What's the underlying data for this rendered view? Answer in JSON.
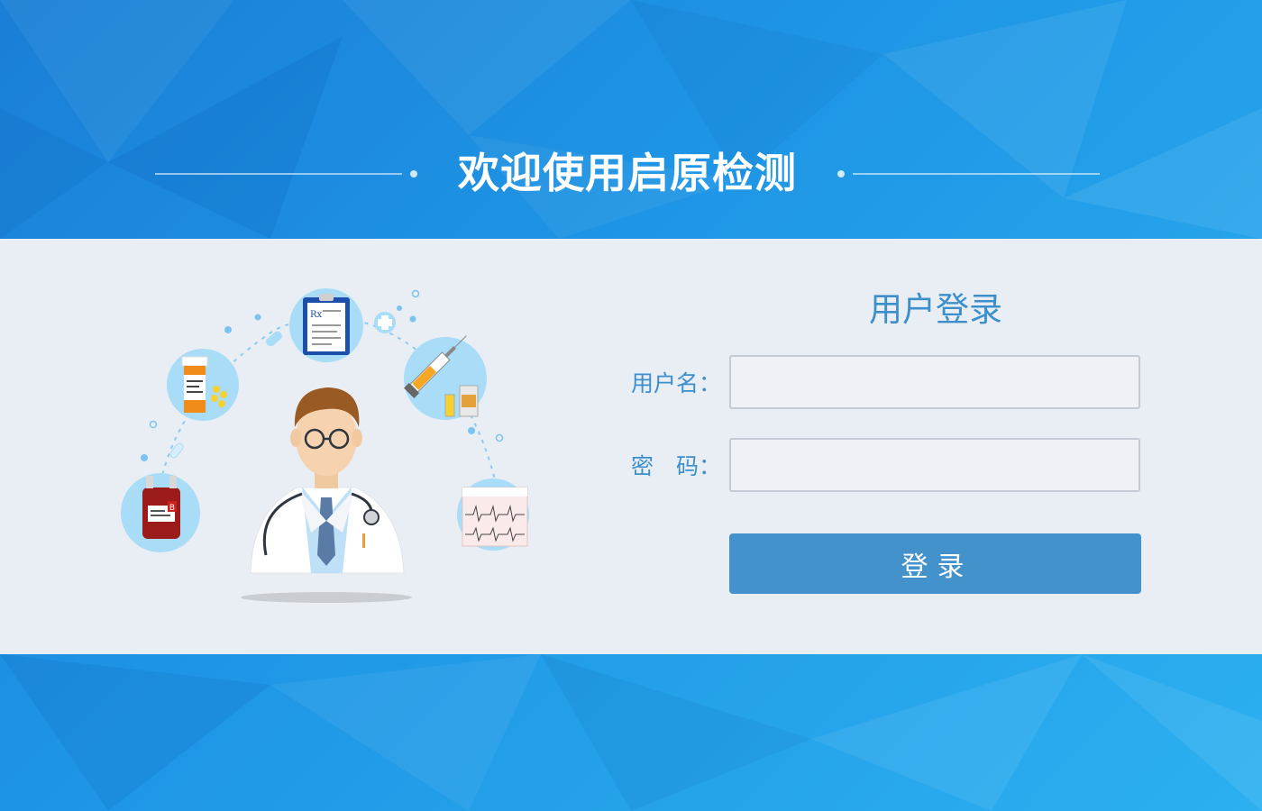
{
  "header": {
    "title": "欢迎使用启原检测"
  },
  "login": {
    "title": "用户登录",
    "username_label": "用户名：",
    "username_value": "",
    "password_label": "密　码：",
    "password_value": "",
    "submit_label": "登录"
  },
  "illustration": {
    "doctor_icon": "doctor-icon",
    "items": [
      "blood-bag-icon",
      "pill-bottle-icon",
      "prescription-clipboard-icon",
      "syringe-vial-icon",
      "ecg-chart-icon"
    ],
    "blood_type": "B",
    "rx_mark": "Rx"
  },
  "colors": {
    "background_blue": "#1f97e6",
    "band": "#e8eef4",
    "accent": "#3d8fcb",
    "button": "#4392cc",
    "circle_fill": "#a9dcf7"
  }
}
